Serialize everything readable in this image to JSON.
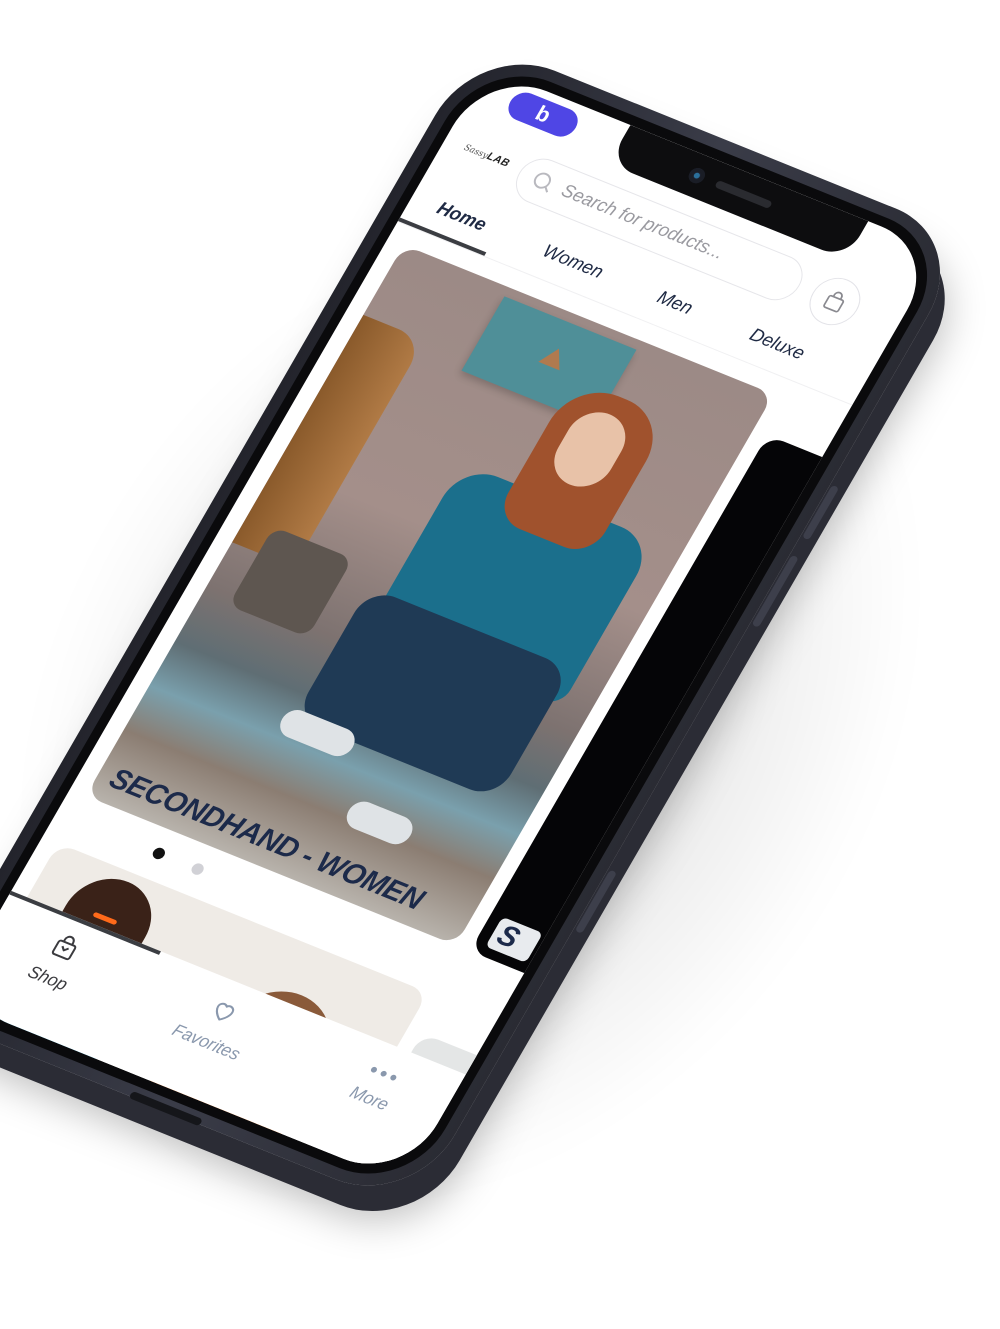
{
  "status_badge": {
    "label": "b",
    "color": "#4f46e5"
  },
  "header": {
    "logo_script": "Sassy",
    "logo_bold": "LAB",
    "search": {
      "placeholder": "Search for products...",
      "value": ""
    },
    "cart_icon": "shopping-bag-icon"
  },
  "tabs": [
    {
      "label": "Home",
      "active": true
    },
    {
      "label": "Women",
      "active": false
    },
    {
      "label": "Men",
      "active": false
    },
    {
      "label": "Deluxe",
      "active": false
    }
  ],
  "carousel": {
    "cards": [
      {
        "label": "SECONDHAND - WOMEN"
      },
      {
        "label": "S"
      }
    ],
    "page_count": 2,
    "active_page": 1
  },
  "promo": {
    "cards": 2
  },
  "tabbar": {
    "items": [
      {
        "label": "Shop",
        "icon": "shopping-bag-icon",
        "active": true
      },
      {
        "label": "Favorites",
        "icon": "heart-icon",
        "active": false
      },
      {
        "label": "More",
        "icon": "more-dots-icon",
        "active": false
      }
    ]
  },
  "colors": {
    "accent": "#4f46e5",
    "text_primary": "#1f2a44",
    "tab_inactive": "#8a98ad",
    "phone_frame": "#2a2b33"
  }
}
